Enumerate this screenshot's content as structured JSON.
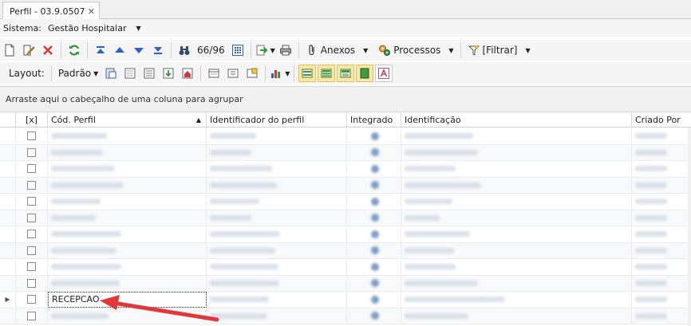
{
  "tab": {
    "title": "Perfil - 03.9.0507",
    "close": "✕"
  },
  "sistema": {
    "label": "Sistema:",
    "value": "Gestão Hospitalar"
  },
  "toolbar1": {
    "counter": "66/96",
    "anexos": "Anexos",
    "processos": "Processos",
    "filtrar": "[Filtrar]"
  },
  "toolbar2": {
    "layout_label": "Layout:",
    "padrao": "Padrão"
  },
  "group_panel": {
    "text": "Arraste aqui o cabeçalho de uma coluna para agrupar"
  },
  "grid": {
    "headers": {
      "check": "[x]",
      "cod_perfil": "Cód. Perfil",
      "identificador": "Identificador do perfil",
      "integrado": "Integrado",
      "identificacao": "Identificação",
      "criado_por": "Criado Por"
    },
    "focused_row": {
      "cod_perfil": "RECEPCAO"
    }
  },
  "colors": {
    "accent_red": "#e0393a",
    "highlight": "#fbe7a4"
  }
}
